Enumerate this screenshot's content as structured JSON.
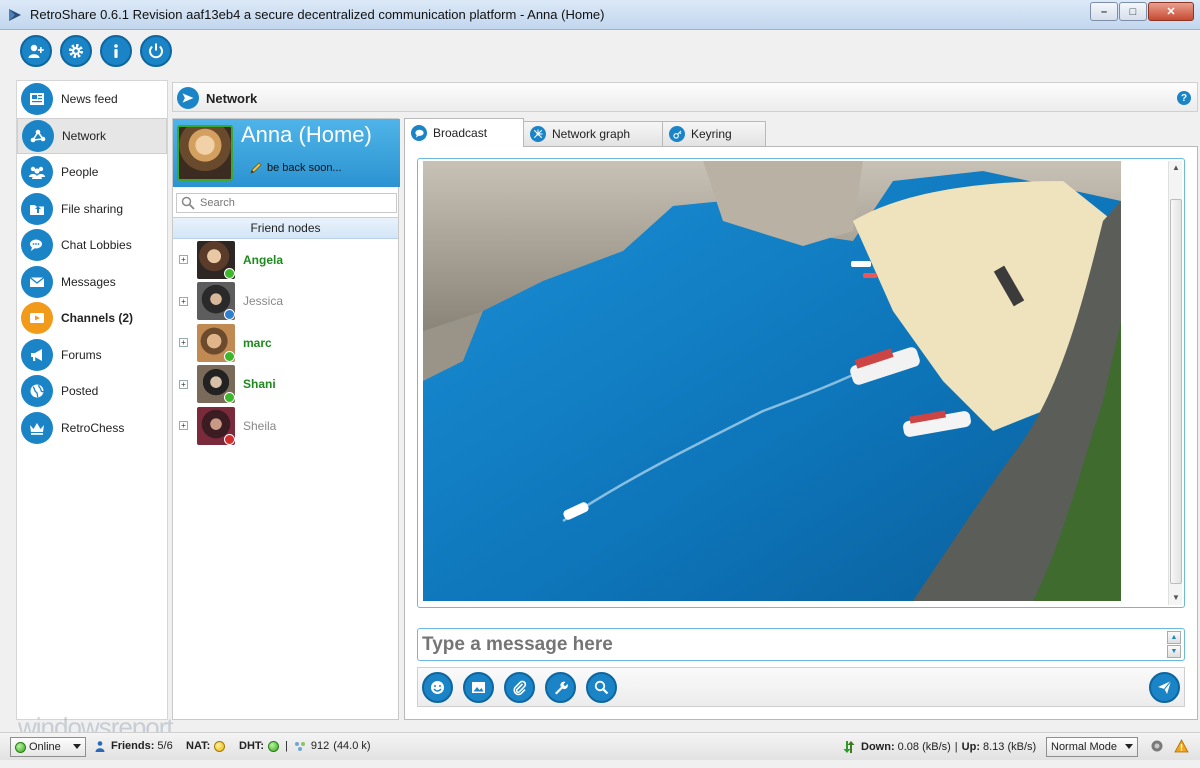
{
  "window": {
    "title": "RetroShare 0.6.1 Revision aaf13eb4 a secure decentralized communication platform - Anna (Home)",
    "minimize": "–",
    "maximize": "□",
    "close": "✕"
  },
  "toolbar": {
    "buttons": [
      {
        "icon": "add-friend-icon"
      },
      {
        "icon": "gear-icon"
      },
      {
        "icon": "info-icon"
      },
      {
        "icon": "power-icon"
      }
    ]
  },
  "nav": {
    "items": [
      {
        "label": "News feed",
        "icon": "newspaper-icon"
      },
      {
        "label": "Network",
        "icon": "network-icon"
      },
      {
        "label": "People",
        "icon": "people-icon"
      },
      {
        "label": "File sharing",
        "icon": "folder-share-icon"
      },
      {
        "label": "Chat Lobbies",
        "icon": "chat-bubbles-icon"
      },
      {
        "label": "Messages",
        "icon": "envelope-icon"
      },
      {
        "label": "Channels (2)",
        "icon": "channel-icon"
      },
      {
        "label": "Forums",
        "icon": "megaphone-icon"
      },
      {
        "label": "Posted",
        "icon": "globe-icon"
      },
      {
        "label": "RetroChess",
        "icon": "crown-icon"
      }
    ],
    "active": "Network",
    "accent": "#1b84c7",
    "channels_color": "#f29a1a"
  },
  "header": {
    "title": "Network",
    "help": "?"
  },
  "profile": {
    "name": "Anna (Home)",
    "status_message": "be back soon..."
  },
  "search": {
    "placeholder": "Search"
  },
  "friends": {
    "header": "Friend nodes",
    "items": [
      {
        "name": "Angela",
        "status": "online",
        "status_color": "#3cb82a"
      },
      {
        "name": "Jessica",
        "status": "away",
        "status_color": "#2f7fd1"
      },
      {
        "name": "marc",
        "status": "online",
        "status_color": "#3cb82a"
      },
      {
        "name": "Shani",
        "status": "online",
        "status_color": "#3cb82a"
      },
      {
        "name": "Sheila",
        "status": "busy",
        "status_color": "#d32d2d"
      }
    ],
    "expander": "+"
  },
  "tabs": [
    {
      "label": "Broadcast",
      "icon": "speech-bubble-icon"
    },
    {
      "label": "Network graph",
      "icon": "graph-icon"
    },
    {
      "label": "Keyring",
      "icon": "key-icon"
    }
  ],
  "chat": {
    "placeholder": "Type a message here",
    "tools": [
      {
        "icon": "smiley-icon"
      },
      {
        "icon": "image-icon"
      },
      {
        "icon": "paperclip-icon"
      },
      {
        "icon": "wrench-icon"
      },
      {
        "icon": "magnifier-icon"
      },
      {
        "icon": "send-icon"
      }
    ]
  },
  "statusbar": {
    "online_label": "Online",
    "friends_label": "Friends:",
    "friends_value": "5/6",
    "nat_label": "NAT:",
    "dht_label": "DHT:",
    "separator": "|",
    "peers_value": "912",
    "peers_size": "(44.0 k)",
    "down_label": "Down:",
    "down_value": "0.08 (kB/s)",
    "up_label": "Up:",
    "up_value": "8.13 (kB/s)",
    "mode": "Normal Mode"
  },
  "watermark": "windowsreport"
}
